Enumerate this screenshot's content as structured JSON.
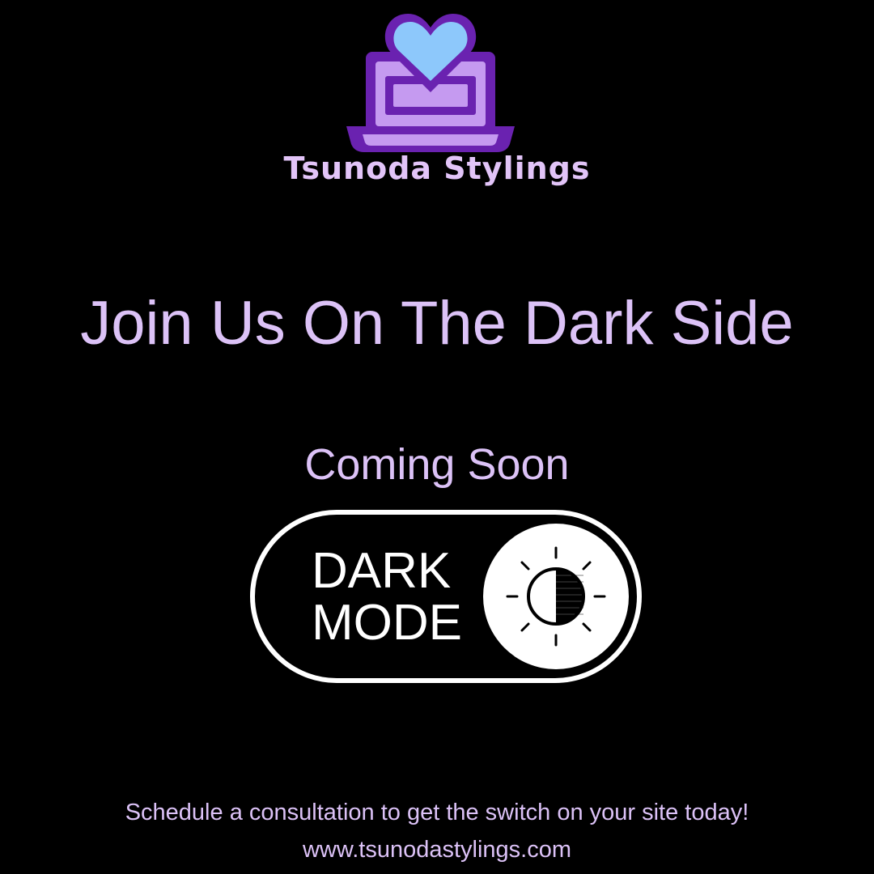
{
  "brand": {
    "name": "Tsunoda Stylings",
    "logo_icon": "laptop-heart-icon",
    "text_color": "#e2c4f8"
  },
  "headline": "Join Us On The Dark Side",
  "subheadline": "Coming Soon",
  "toggle": {
    "line1": "DARK",
    "line2": "MODE",
    "icon": "brightness-contrast-icon",
    "state": "on"
  },
  "footer": {
    "cta": "Schedule a consultation to get the switch on your site today!",
    "url": "www.tsunodastylings.com"
  },
  "colors": {
    "background": "#000000",
    "accent_lavender": "#dcc2f7",
    "logo_purple_dark": "#6a22b0",
    "logo_purple_light": "#c59af0",
    "logo_heart_blue": "#8dc8fb"
  }
}
